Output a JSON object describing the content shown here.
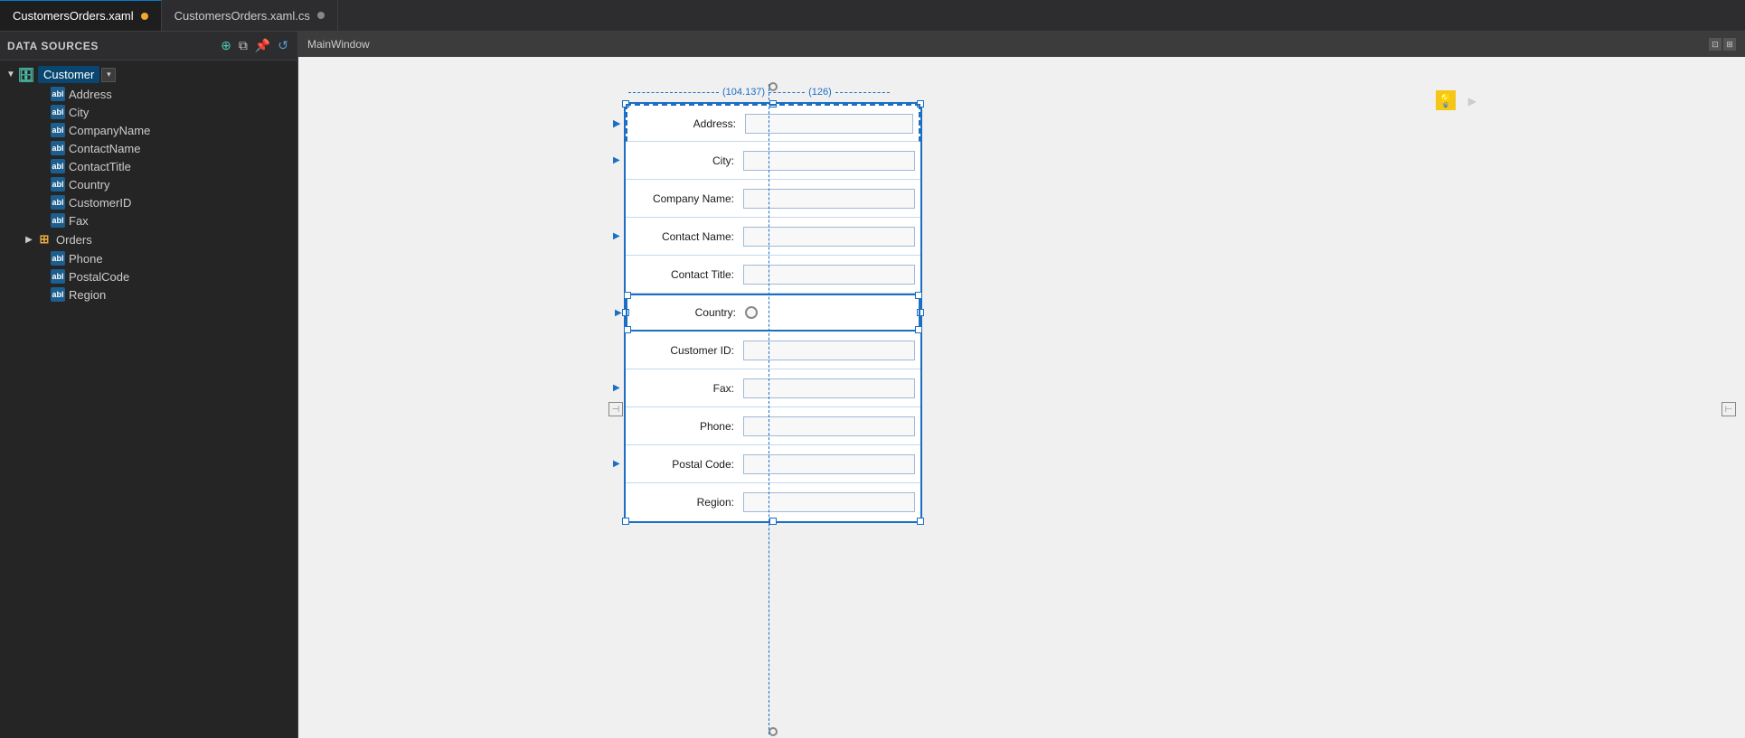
{
  "tabs": [
    {
      "label": "CustomersOrders.xaml",
      "active": true,
      "dot": "orange"
    },
    {
      "label": "CustomersOrders.xaml.cs",
      "active": false,
      "dot": "gray"
    }
  ],
  "sidebar": {
    "title": "Data Sources",
    "icons": [
      "+",
      "⧉",
      "↩",
      "↺"
    ],
    "tree": {
      "root": {
        "label": "Customer",
        "expanded": true,
        "selected": true,
        "children": [
          {
            "label": "Address",
            "type": "field"
          },
          {
            "label": "City",
            "type": "field"
          },
          {
            "label": "CompanyName",
            "type": "field"
          },
          {
            "label": "ContactName",
            "type": "field"
          },
          {
            "label": "ContactTitle",
            "type": "field"
          },
          {
            "label": "Country",
            "type": "field"
          },
          {
            "label": "CustomerID",
            "type": "field"
          },
          {
            "label": "Fax",
            "type": "field"
          },
          {
            "label": "Orders",
            "type": "table",
            "expandable": true
          },
          {
            "label": "Phone",
            "type": "field"
          },
          {
            "label": "PostalCode",
            "type": "field"
          },
          {
            "label": "Region",
            "type": "field"
          }
        ]
      }
    }
  },
  "designer": {
    "window_title": "MainWindow",
    "measure_left": "(104.137)",
    "measure_right": "(126)",
    "form_fields": [
      {
        "label": "Address:",
        "type": "text",
        "dashed": false
      },
      {
        "label": "City:",
        "type": "text",
        "dashed": false
      },
      {
        "label": "Company Name:",
        "type": "text",
        "dashed": false
      },
      {
        "label": "Contact Name:",
        "type": "text",
        "dashed": false
      },
      {
        "label": "Contact Title:",
        "type": "text",
        "dashed": false
      },
      {
        "label": "Country:",
        "type": "radio",
        "dashed": false
      },
      {
        "label": "Customer ID:",
        "type": "text",
        "dashed": false
      },
      {
        "label": "Fax:",
        "type": "text",
        "dashed": false
      },
      {
        "label": "Phone:",
        "type": "text",
        "dashed": false
      },
      {
        "label": "Postal Code:",
        "type": "text",
        "dashed": false
      },
      {
        "label": "Region:",
        "type": "text",
        "dashed": false
      }
    ]
  }
}
